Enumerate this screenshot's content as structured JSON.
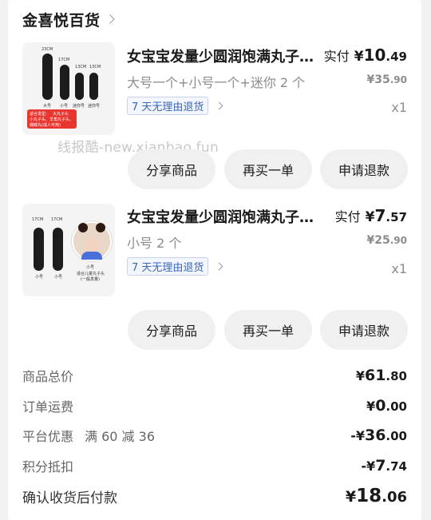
{
  "shop": {
    "name": "金喜悦百货"
  },
  "watermark": "线报酷-new.xianbao.fun",
  "products": [
    {
      "title": "女宝宝发量少圆润饱满丸子头神器",
      "price_label": "实付",
      "price_yuan": "¥",
      "price_int": "10",
      "price_dec": ".49",
      "spec": "大号一个+小号一个+迷你 2 个",
      "orig_price_int": "¥35",
      "orig_price_dec": ".90",
      "return_policy": "7 天无理由退货",
      "quantity": "x1",
      "image_text": {
        "sizes": [
          "23CM",
          "17CM",
          "13CM",
          "13CM"
        ],
        "names": [
          "大号",
          "小号",
          "迷你号",
          "迷你号"
        ],
        "note_title": "适合发型:",
        "note_lines": [
          "大丸子头",
          "小丸子头、羊角丸子头、",
          "蝴蝶丸(成人可用)"
        ]
      }
    },
    {
      "title": "女宝宝发量少圆润饱满丸子头神器",
      "price_label": "实付",
      "price_yuan": "¥",
      "price_int": "7",
      "price_dec": ".57",
      "spec": "小号 2 个",
      "orig_price_int": "¥25",
      "orig_price_dec": ".90",
      "return_policy": "7 天无理由退货",
      "quantity": "x1",
      "image_text": {
        "sizes": [
          "17CM",
          "17CM"
        ],
        "names": [
          "小号",
          "小号"
        ],
        "caption_title": "小号",
        "caption_lines": [
          "适合儿童丸子头",
          "(一般发量)"
        ]
      }
    }
  ],
  "actions": {
    "share": "分享商品",
    "rebuy": "再买一单",
    "refund": "申请退款"
  },
  "summary": {
    "items_total": {
      "label": "商品总价",
      "yuan": "¥",
      "int": "61",
      "dec": ".80"
    },
    "shipping": {
      "label": "订单运费",
      "yuan": "¥",
      "int": "0",
      "dec": ".00"
    },
    "platform_discount": {
      "label": "平台优惠",
      "promo": "满 60 减 36",
      "yuan": "-¥",
      "int": "36",
      "dec": ".00"
    },
    "points": {
      "label": "积分抵扣",
      "yuan": "-¥",
      "int": "7",
      "dec": ".74"
    },
    "final": {
      "label": "确认收货后付款",
      "yuan": "¥",
      "int": "18",
      "dec": ".06"
    }
  }
}
